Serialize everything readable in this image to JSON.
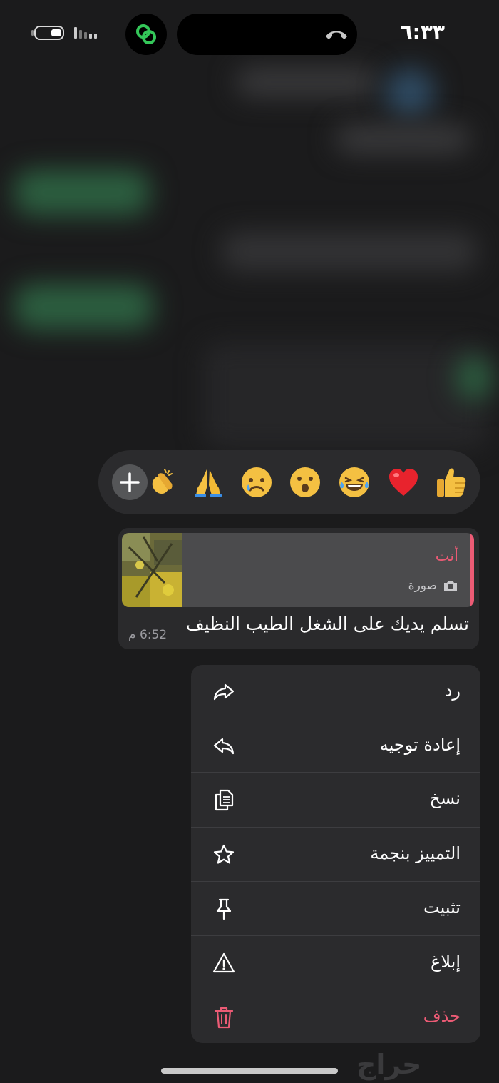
{
  "status_bar": {
    "time": "٦:٣٣",
    "link_icon": "link-icon",
    "end_call_icon": "end-call-icon",
    "battery_icon": "battery-icon",
    "signal_icon": "signal-icon"
  },
  "reactions": {
    "add_icon": "plus-icon",
    "emojis": [
      "👍",
      "❤️",
      "😂",
      "😮",
      "😢",
      "🙏",
      "👏"
    ]
  },
  "message": {
    "quote_author": "أنت",
    "quote_type": "صورة",
    "quote_type_icon": "camera-icon",
    "text": "تسلم يديك على الشغل الطيب النظيف",
    "time": "6:52 م"
  },
  "menu": {
    "items": [
      {
        "label": "رد",
        "icon": "reply-icon"
      },
      {
        "label": "إعادة توجيه",
        "icon": "forward-icon"
      },
      {
        "label": "نسخ",
        "icon": "copy-icon"
      },
      {
        "label": "التمييز بنجمة",
        "icon": "star-icon"
      },
      {
        "label": "تثبيت",
        "icon": "pin-icon"
      },
      {
        "label": "إبلاغ",
        "icon": "warning-icon"
      },
      {
        "label": "حذف",
        "icon": "trash-icon",
        "danger": true
      }
    ]
  },
  "watermark": "حراج",
  "colors": {
    "accent": "#ec5b75",
    "background": "#1b1b1c",
    "surface": "#2b2b2d"
  }
}
